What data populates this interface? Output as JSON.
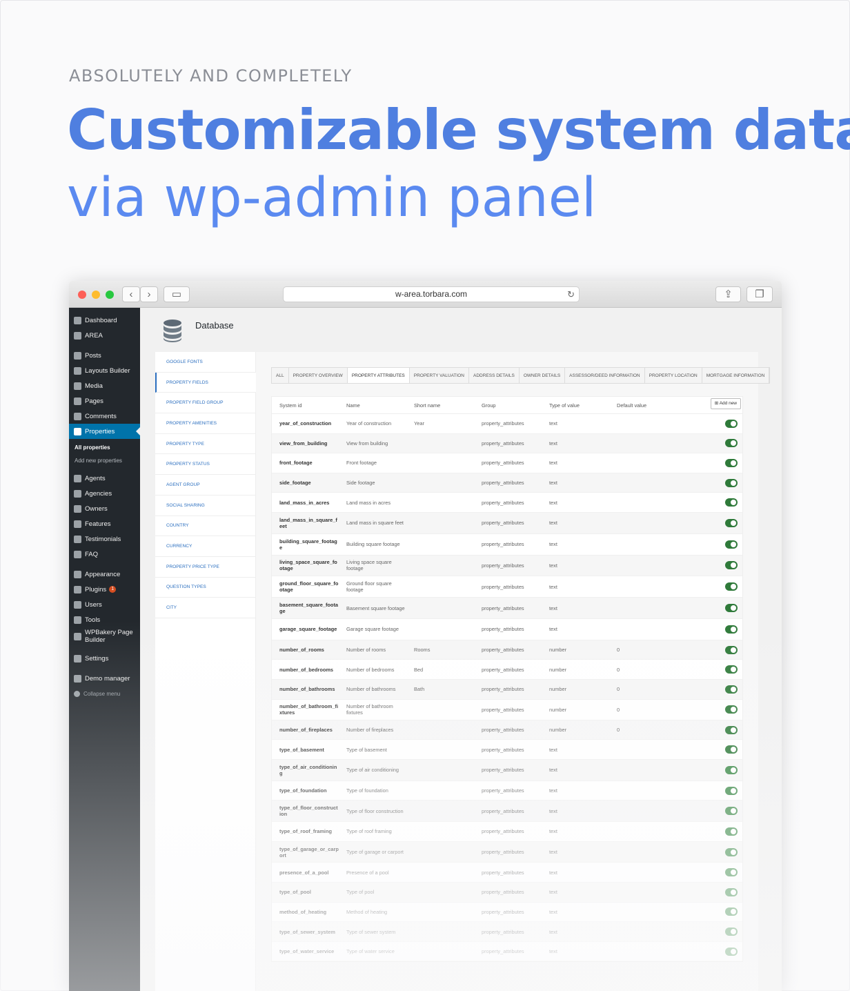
{
  "hero": {
    "eyebrow": "ABSOLUTELY AND COMPLETELY",
    "headline": "Customizable system data",
    "subhead": "via wp-admin panel"
  },
  "browser": {
    "url": "w-area.torbara.com"
  },
  "wp_menu": {
    "items": [
      {
        "label": "Dashboard"
      },
      {
        "label": "AREA"
      },
      {
        "label": "Posts"
      },
      {
        "label": "Layouts Builder"
      },
      {
        "label": "Media"
      },
      {
        "label": "Pages"
      },
      {
        "label": "Comments"
      },
      {
        "label": "Properties"
      },
      {
        "label": "Agents"
      },
      {
        "label": "Agencies"
      },
      {
        "label": "Owners"
      },
      {
        "label": "Features"
      },
      {
        "label": "Testimonials"
      },
      {
        "label": "FAQ"
      },
      {
        "label": "Appearance"
      },
      {
        "label": "Plugins"
      },
      {
        "label": "Users"
      },
      {
        "label": "Tools"
      },
      {
        "label": "WPBakery Page Builder"
      },
      {
        "label": "Settings"
      },
      {
        "label": "Demo manager"
      },
      {
        "label": "Collapse menu"
      }
    ],
    "submenu": [
      "All properties",
      "Add new properties"
    ],
    "plugins_badge": "1"
  },
  "page": {
    "title": "Database",
    "left_nav": [
      "GOOGLE FONTS",
      "PROPERTY FIELDS",
      "PROPERTY FIELD GROUP",
      "PROPERTY AMENITIES",
      "PROPERTY TYPE",
      "PROPERTY STATUS",
      "AGENT GROUP",
      "SOCIAL SHARING",
      "COUNTRY",
      "CURRENCY",
      "PROPERTY PRICE TYPE",
      "QUESTION TYPES",
      "CITY"
    ],
    "tabs": [
      "ALL",
      "PROPERTY OVERVIEW",
      "PROPERTY ATTRIBUTES",
      "PROPERTY VALUATION",
      "ADDRESS DETAILS",
      "OWNER DETAILS",
      "ASSESSOR/DEED INFORMATION",
      "PROPERTY LOCATION",
      "MORTGAGE INFORMATION"
    ],
    "add_new": "Add new",
    "columns": [
      "System id",
      "Name",
      "Short name",
      "Group",
      "Type of value",
      "Default value"
    ],
    "rows": [
      [
        "year_of_construction",
        "Year of construction",
        "Year",
        "property_attributes",
        "text",
        ""
      ],
      [
        "view_from_building",
        "View from building",
        "",
        "property_attributes",
        "text",
        ""
      ],
      [
        "front_footage",
        "Front footage",
        "",
        "property_attributes",
        "text",
        ""
      ],
      [
        "side_footage",
        "Side footage",
        "",
        "property_attributes",
        "text",
        ""
      ],
      [
        "land_mass_in_acres",
        "Land mass in acres",
        "",
        "property_attributes",
        "text",
        ""
      ],
      [
        "land_mass_in_square_feet",
        "Land mass in square feet",
        "",
        "property_attributes",
        "text",
        ""
      ],
      [
        "building_square_footage",
        "Building square footage",
        "",
        "property_attributes",
        "text",
        ""
      ],
      [
        "living_space_square_footage",
        "Living space square footage",
        "",
        "property_attributes",
        "text",
        ""
      ],
      [
        "ground_floor_square_footage",
        "Ground floor square footage",
        "",
        "property_attributes",
        "text",
        ""
      ],
      [
        "basement_square_footage",
        "Basement square footage",
        "",
        "property_attributes",
        "text",
        ""
      ],
      [
        "garage_square_footage",
        "Garage square footage",
        "",
        "property_attributes",
        "text",
        ""
      ],
      [
        "number_of_rooms",
        "Number of rooms",
        "Rooms",
        "property_attributes",
        "number",
        "0"
      ],
      [
        "number_of_bedrooms",
        "Number of bedrooms",
        "Bed",
        "property_attributes",
        "number",
        "0"
      ],
      [
        "number_of_bathrooms",
        "Number of bathrooms",
        "Bath",
        "property_attributes",
        "number",
        "0"
      ],
      [
        "number_of_bathroom_fixtures",
        "Number of bathroom fixtures",
        "",
        "property_attributes",
        "number",
        "0"
      ],
      [
        "number_of_fireplaces",
        "Number of fireplaces",
        "",
        "property_attributes",
        "number",
        "0"
      ],
      [
        "type_of_basement",
        "Type of basement",
        "",
        "property_attributes",
        "text",
        ""
      ],
      [
        "type_of_air_conditioning",
        "Type of air conditioning",
        "",
        "property_attributes",
        "text",
        ""
      ],
      [
        "type_of_foundation",
        "Type of foundation",
        "",
        "property_attributes",
        "text",
        ""
      ],
      [
        "type_of_floor_construction",
        "Type of floor construction",
        "",
        "property_attributes",
        "text",
        ""
      ],
      [
        "type_of_roof_framing",
        "Type of roof framing",
        "",
        "property_attributes",
        "text",
        ""
      ],
      [
        "type_of_garage_or_carport",
        "Type of garage or carport",
        "",
        "property_attributes",
        "text",
        ""
      ],
      [
        "presence_of_a_pool",
        "Presence of a pool",
        "",
        "property_attributes",
        "text",
        ""
      ],
      [
        "type_of_pool",
        "Type of pool",
        "",
        "property_attributes",
        "text",
        ""
      ],
      [
        "method_of_heating",
        "Method of heating",
        "",
        "property_attributes",
        "text",
        ""
      ],
      [
        "type_of_sewer_system",
        "Type of sewer system",
        "",
        "property_attributes",
        "text",
        ""
      ],
      [
        "type_of_water_service",
        "Type of water service",
        "",
        "property_attributes",
        "text",
        ""
      ]
    ]
  },
  "colors": {
    "accent": "#4f7fe0",
    "wp_active": "#0073aa",
    "toggle_on": "#2f7a3a"
  }
}
